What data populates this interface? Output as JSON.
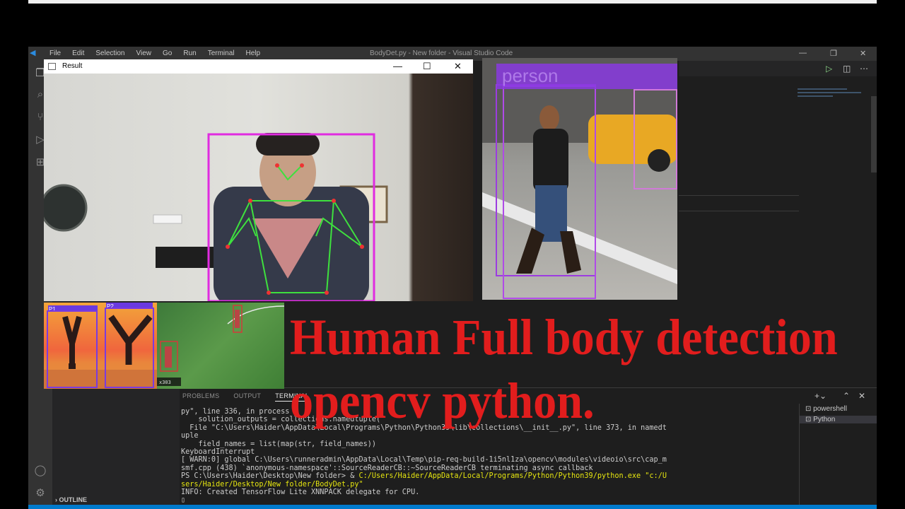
{
  "editor": {
    "window_title": "BodyDet.py - New folder - Visual Studio Code",
    "menu": [
      "File",
      "Edit",
      "Selection",
      "View",
      "Go",
      "Run",
      "Terminal",
      "Help"
    ],
    "outline_label": "OUTLINE"
  },
  "result_window": {
    "title": "Result"
  },
  "street_overlay": {
    "label": "person"
  },
  "thumbnails": {
    "labels": [
      "P1",
      "P2"
    ],
    "corner_text": "x303"
  },
  "headline": {
    "line1": "Human Full body detection",
    "line2": "opencv python."
  },
  "panel": {
    "tabs": [
      "PROBLEMS",
      "OUTPUT",
      "TERMINAL"
    ],
    "terminals": [
      "powershell",
      "Python"
    ],
    "lines": [
      "py\", line 336, in process",
      "    solution_outputs = collections.namedtuple(",
      "  File \"C:\\Users\\Haider\\AppData\\Local\\Programs\\Python\\Python39\\lib\\collections\\__init__.py\", line 373, in namedt",
      "uple",
      "    field_names = list(map(str, field_names))",
      "KeyboardInterrupt",
      "[ WARN:0] global C:\\Users\\runneradmin\\AppData\\Local\\Temp\\pip-req-build-1i5nl1za\\opencv\\modules\\videoio\\src\\cap_m",
      "smf.cpp (438) `anonymous-namespace'::SourceReaderCB::~SourceReaderCB terminating async callback",
      "INFO: Created TensorFlow Lite XNNPACK delegate for CPU."
    ],
    "prompt": "PS C:\\Users\\Haider\\Desktop\\New folder> & ",
    "command": "C:/Users/Haider/AppData/Local/Programs/Python/Python39/python.exe \"c:/U",
    "command_cont": "sers/Haider/Desktop/New folder/BodyDet.py\""
  },
  "colors": {
    "accent": "#007acc",
    "headline": "#e21d1d",
    "box_magenta": "#e02be0",
    "skeleton": "#3ee03e"
  }
}
